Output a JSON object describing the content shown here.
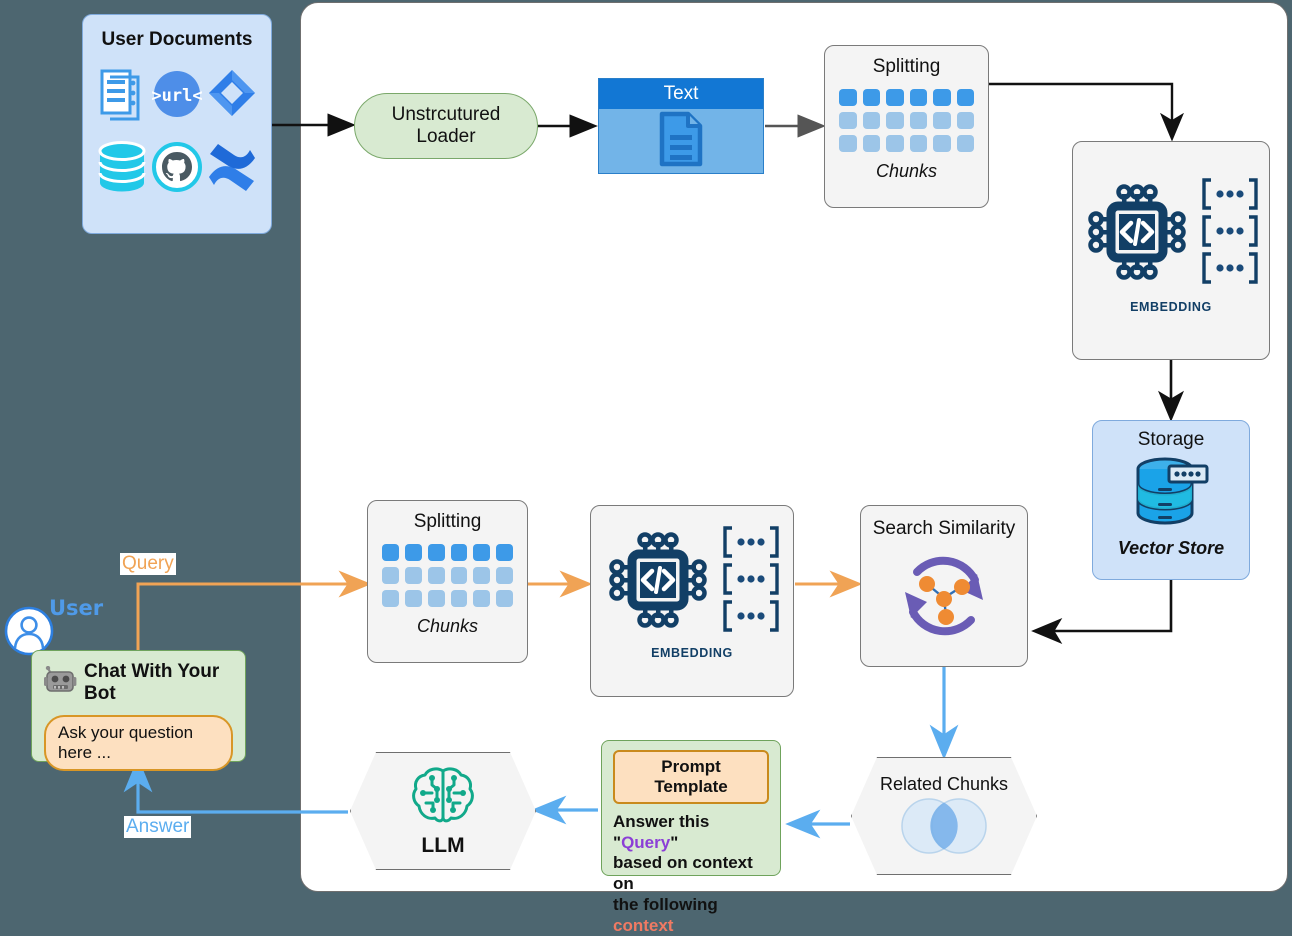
{
  "diagram": {
    "title": "RAG Pipeline",
    "background_color": "#4d6670",
    "panel_color": "#ffffff"
  },
  "user_documents": {
    "title": "User Documents",
    "icons": [
      {
        "name": "documents-icon",
        "label": "Documents"
      },
      {
        "name": "url-icon",
        "label": "url"
      },
      {
        "name": "jira-icon",
        "label": "Jira"
      },
      {
        "name": "database-icon",
        "label": "Database"
      },
      {
        "name": "github-icon",
        "label": "GitHub"
      },
      {
        "name": "confluence-icon",
        "label": "Confluence"
      }
    ]
  },
  "loader": {
    "line1": "Unstrcutured",
    "line2": "Loader"
  },
  "text_node": {
    "header": "Text"
  },
  "splitting_ingest": {
    "title": "Splitting",
    "subtitle": "Chunks",
    "rows": 3,
    "cols": 6
  },
  "embedding_ingest": {
    "label": "EMBEDDING",
    "vector_rows": [
      "...",
      "...",
      "..."
    ]
  },
  "storage": {
    "title": "Storage",
    "subtitle": "Vector Store"
  },
  "splitting_query": {
    "title": "Splitting",
    "subtitle": "Chunks",
    "rows": 3,
    "cols": 6
  },
  "embedding_query": {
    "label": "EMBEDDING",
    "vector_rows": [
      "...",
      "...",
      "..."
    ]
  },
  "search_similarity": {
    "title": "Search Similarity"
  },
  "related_chunks": {
    "title": "Related Chunks"
  },
  "prompt_template": {
    "badge": "Prompt Template",
    "line1_a": "Answer this \"",
    "line1_q": "Query",
    "line1_b": "\"",
    "line2": "based on context on",
    "line3_a": "the following ",
    "line3_c": "context"
  },
  "llm": {
    "title": "LLM"
  },
  "user": {
    "label": "User"
  },
  "chat": {
    "title": "Chat With Your Bot",
    "input_value": "Ask your question here ..."
  },
  "edges": {
    "query_label": "Query",
    "answer_label": "Answer"
  },
  "colors": {
    "query_orange": "#f0a355",
    "answer_blue": "#5badef",
    "ingest_black": "#111111",
    "embed_navy": "#123f66",
    "chunk_blue": "#3d9ae8",
    "purple": "#6a5cb5",
    "orange_node": "#ef8b33"
  }
}
